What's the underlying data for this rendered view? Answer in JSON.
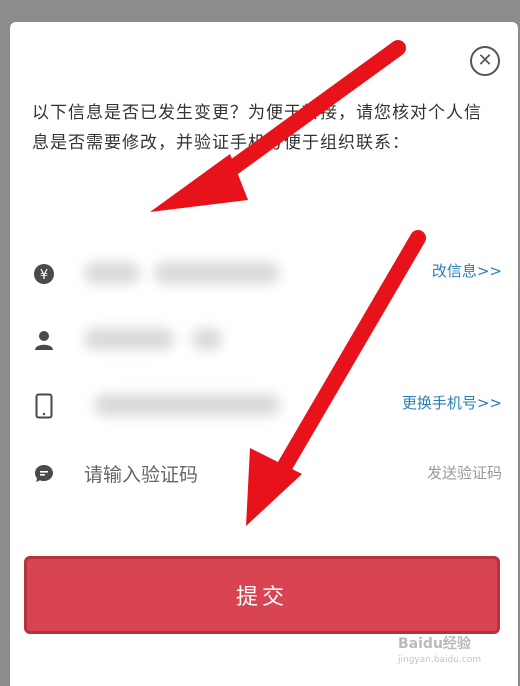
{
  "dialog": {
    "intro_text": "以下信息是否已发生变更？为便于转接，请您核对个人信息是否需要修改，并验证手机号便于组织联系：",
    "close_icon": "close-circle-icon"
  },
  "rows": {
    "info": {
      "icon": "yen-icon",
      "link_label": "改信息>>"
    },
    "name": {
      "icon": "person-icon"
    },
    "phone": {
      "icon": "phone-icon",
      "link_label": "更换手机号>>"
    },
    "code": {
      "icon": "chat-icon",
      "placeholder": "请输入验证码",
      "send_label": "发送验证码"
    }
  },
  "submit": {
    "label": "提交"
  },
  "watermark": {
    "brand": "Baidu经验",
    "url": "jingyan.baidu.com"
  },
  "colors": {
    "accent": "#d94452",
    "link": "#2e7fb5",
    "annotation_arrow": "#e8121a"
  }
}
